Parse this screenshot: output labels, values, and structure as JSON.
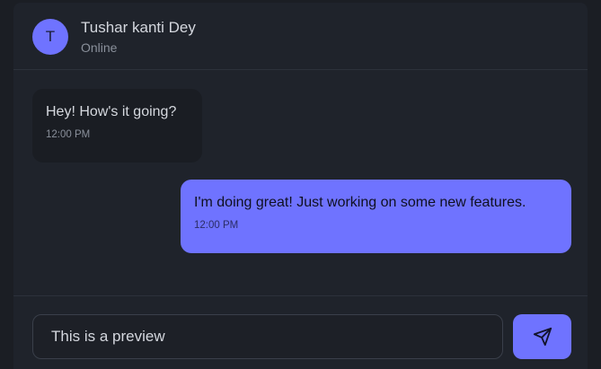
{
  "colors": {
    "accent": "#6f73ff",
    "panel": "#1f232b",
    "incoming_bubble": "#1a1d23"
  },
  "header": {
    "avatar_initial": "T",
    "name": "Tushar kanti Dey",
    "status": "Online"
  },
  "messages": [
    {
      "direction": "incoming",
      "text": "Hey! How's it going?",
      "time": "12:00 PM"
    },
    {
      "direction": "outgoing",
      "text": "I'm doing great! Just working on some new features.",
      "time": "12:00 PM"
    }
  ],
  "composer": {
    "input_value": "This is a preview",
    "send_icon": "paper-plane-icon"
  }
}
